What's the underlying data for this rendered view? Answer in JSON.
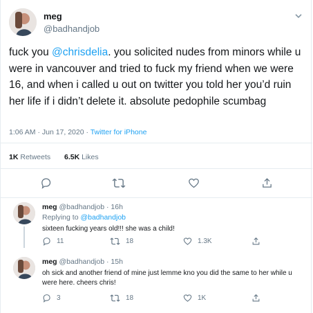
{
  "main_tweet": {
    "name": "meg",
    "handle": "@badhandjob",
    "text_prefix": "fuck you ",
    "mention": "@chrisdelia",
    "text_suffix": ". you solicited nudes from minors while u were in vancouver and tried to fuck my friend when we were 16, and when i called u out on twitter you told her you’d ruin her life if i didn’t delete it. absolute pedophile scumbag",
    "timestamp": "1:06 AM · Jun 17, 2020 · ",
    "source": "Twitter for iPhone",
    "retweets_count": "1K",
    "retweets_label": "Retweets",
    "likes_count": "6.5K",
    "likes_label": "Likes"
  },
  "replies": [
    {
      "name": "meg",
      "handle": "@badhandjob · 16h",
      "replying_prefix": "Replying to ",
      "replying_to": "@badhandjob",
      "text": "sixteen fucking years old!!! she was a child!",
      "reply_count": "11",
      "retweet_count": "18",
      "like_count": "1.3K"
    },
    {
      "name": "meg",
      "handle": "@badhandjob · 15h",
      "text": "oh sick and another friend of mine just lemme kno you did the same to her while u were here. cheers chris!",
      "reply_count": "3",
      "retweet_count": "18",
      "like_count": "1K"
    }
  ],
  "icons": {
    "caret": "chevron-down-icon",
    "reply": "reply-icon",
    "retweet": "retweet-icon",
    "like": "like-icon",
    "share": "share-icon"
  },
  "colors": {
    "link": "#1da1f2",
    "muted": "#657786",
    "text": "#14171a",
    "divider": "#e6ecf0"
  }
}
